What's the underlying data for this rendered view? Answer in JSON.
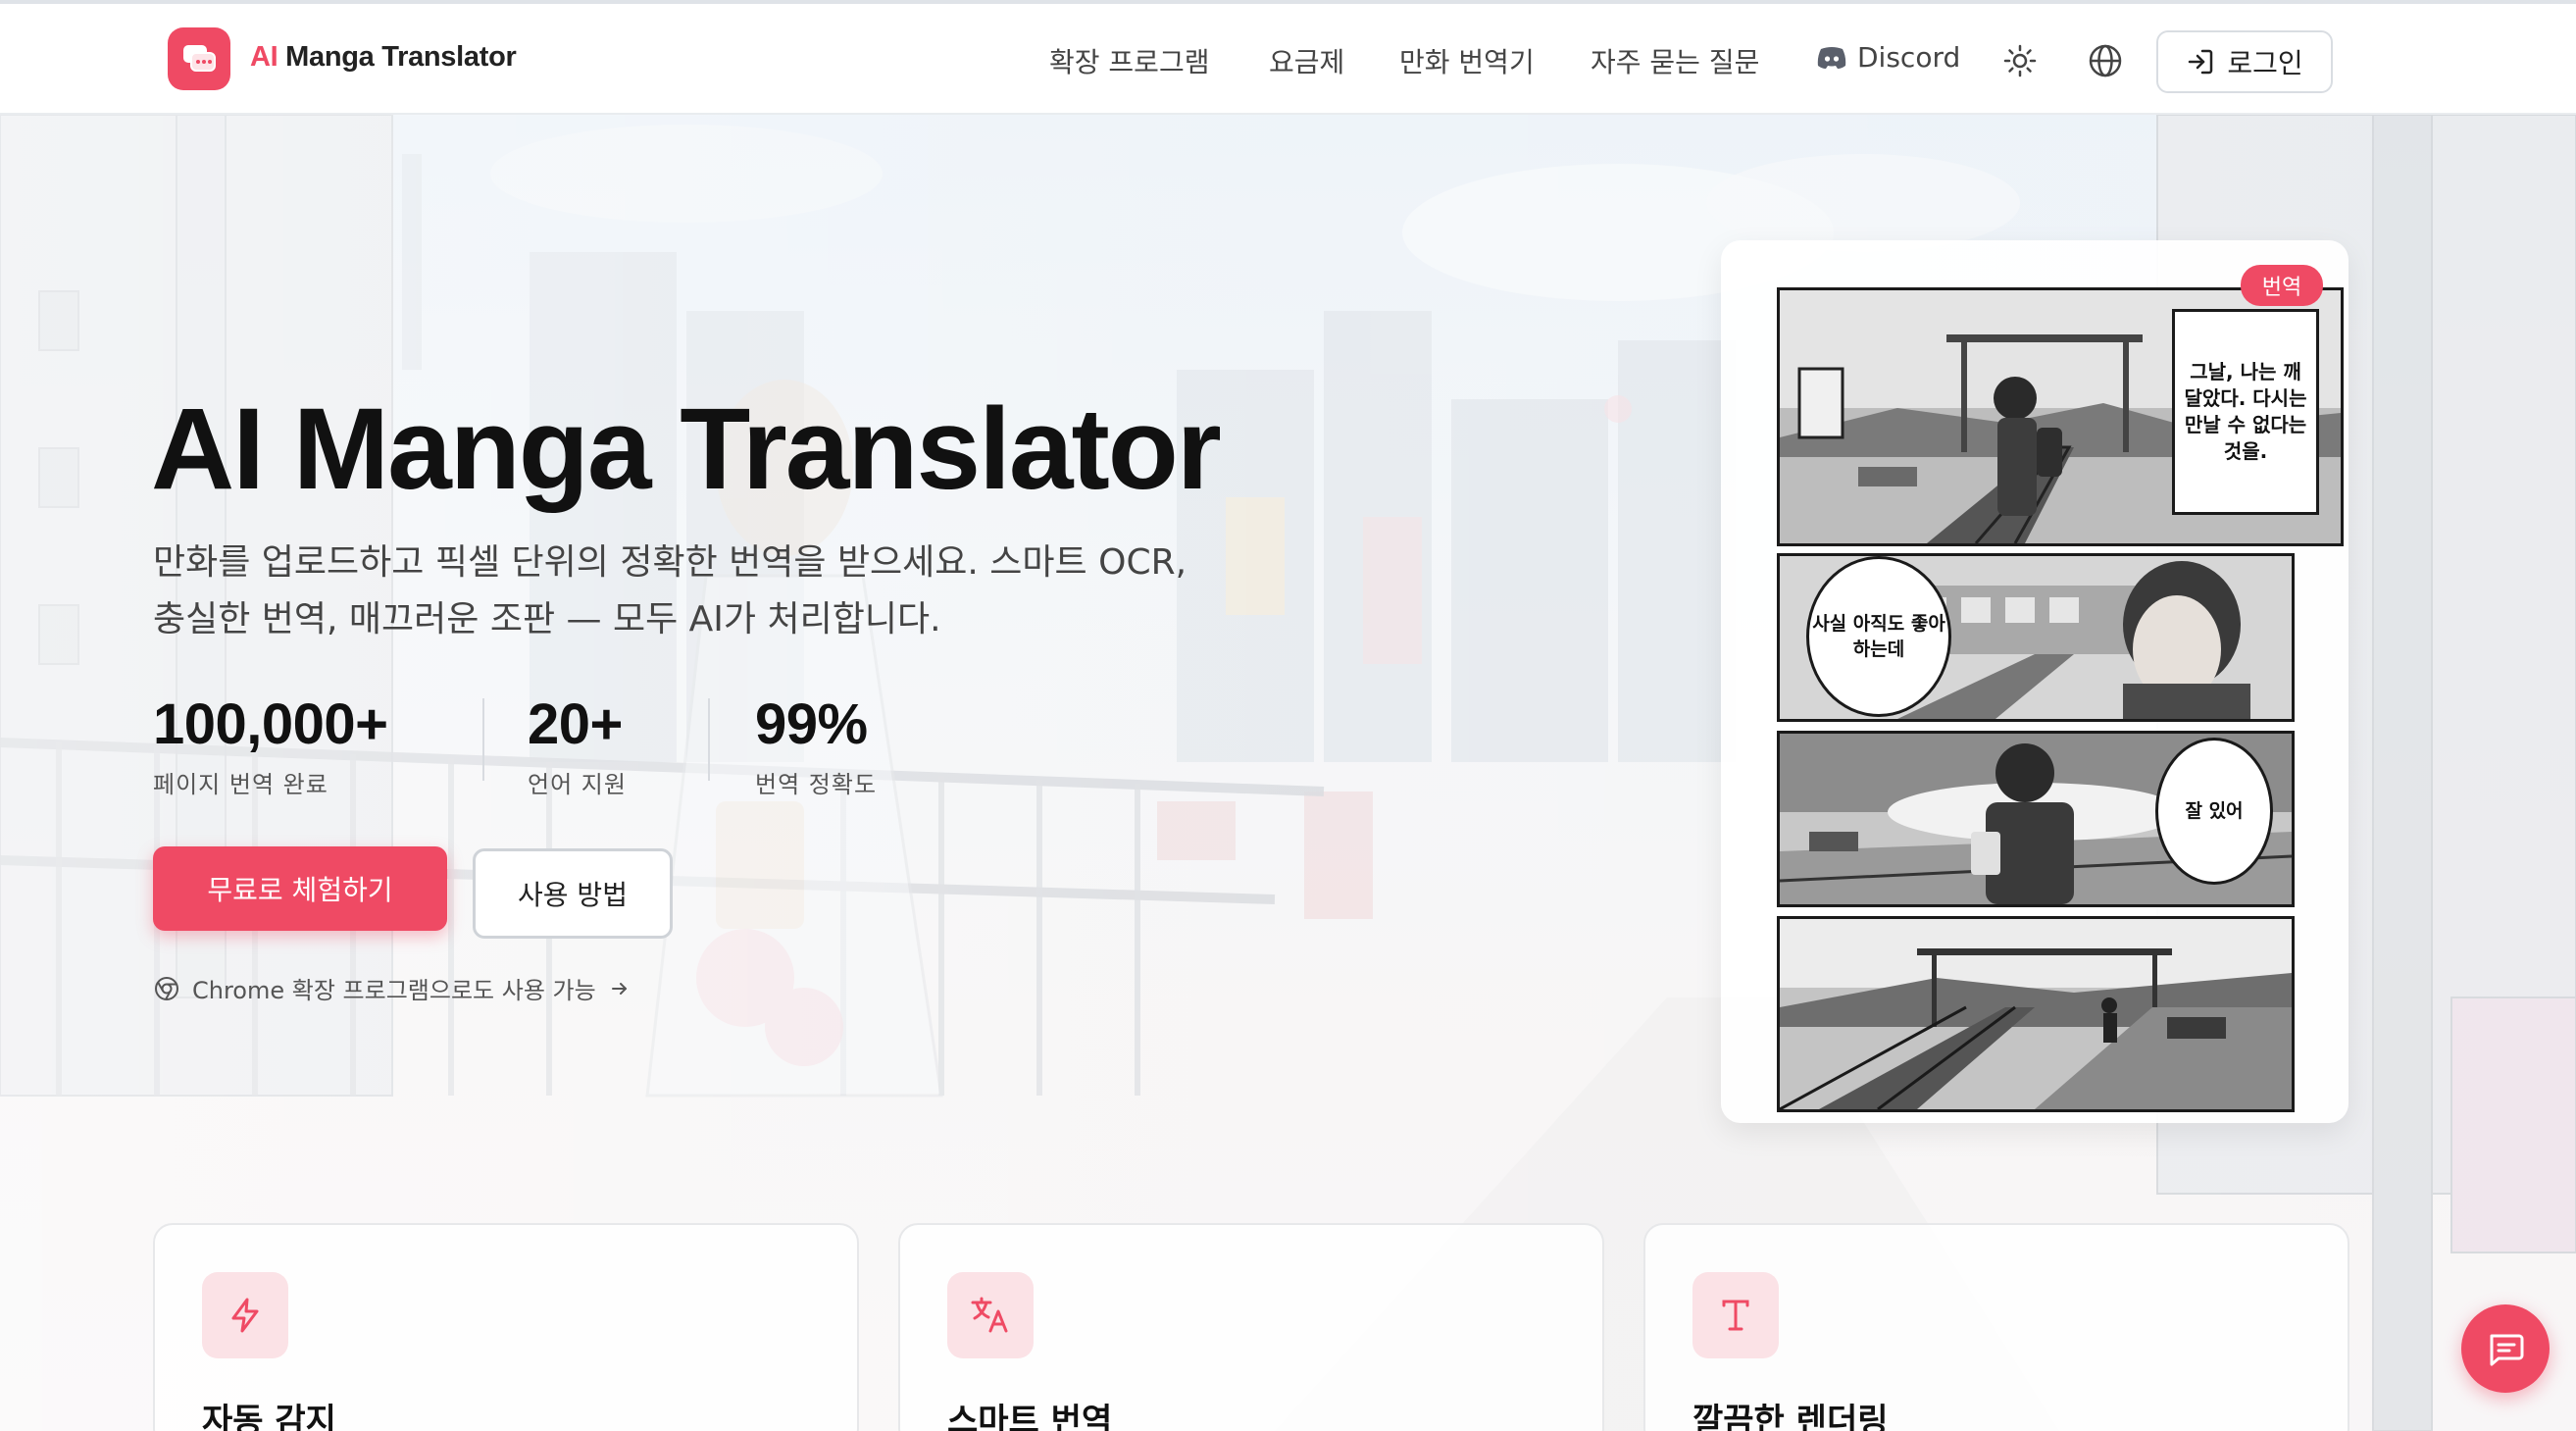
{
  "header": {
    "brand_ai": "AI",
    "brand_rest": " Manga Translator",
    "nav": [
      {
        "label": "확장 프로그램"
      },
      {
        "label": "요금제"
      },
      {
        "label": "만화 번역기"
      },
      {
        "label": "자주 묻는 질문"
      },
      {
        "label": "Discord"
      }
    ],
    "login_label": "로그인",
    "icons": [
      "chat-logo-icon",
      "discord-icon",
      "sun-icon",
      "globe-icon",
      "login-icon"
    ]
  },
  "hero": {
    "title": "AI Manga Translator",
    "subtitle": "만화를 업로드하고 픽셀 단위의 정확한 번역을 받으세요. 스마트 OCR, 충실한 번역, 매끄러운 조판 — 모두 AI가 처리합니다.",
    "stats": [
      {
        "value": "100,000+",
        "label": "페이지 번역 완료"
      },
      {
        "value": "20+",
        "label": "언어 지원"
      },
      {
        "value": "99%",
        "label": "번역 정확도"
      }
    ],
    "cta_primary": "무료로 체험하기",
    "cta_secondary": "사용 방법",
    "chrome_note": "Chrome 확장 프로그램으로도 사용 가능"
  },
  "manga": {
    "badge": "번역",
    "panel1_caption": "그날, 나는 깨달았다. 다시는 만날 수 없다는 것을.",
    "panel2_bubble": "사실 아직도 좋아하는데",
    "panel3_bubble": "잘 있어"
  },
  "features": [
    {
      "title": "자동 감지",
      "icon": "lightning-icon"
    },
    {
      "title": "스마트 번역",
      "icon": "translate-icon"
    },
    {
      "title": "깔끔한 렌더링",
      "icon": "text-T-icon"
    }
  ],
  "colors": {
    "accent": "#ef4a64",
    "text": "#111111",
    "muted": "#555555"
  }
}
